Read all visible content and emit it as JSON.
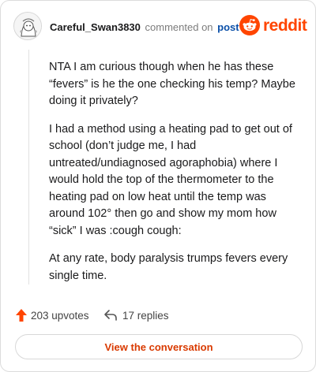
{
  "comment": {
    "username": "Careful_Swan3830",
    "action_text": "commented on",
    "post_link": "post",
    "paragraphs": [
      "NTA I am curious though when he has these “fevers” is he the one checking his temp? Maybe doing it privately?",
      "I had a method using a heating pad to get out of school (don’t judge me, I had untreated/undiagnosed agoraphobia) where I would hold the top of the thermometer to the heating pad on low heat until the temp was around 102° then go and show my mom how “sick” I was :cough cough:",
      "At any rate, body paralysis trumps fevers every single time."
    ]
  },
  "brand": {
    "name": "reddit",
    "color": "#ff4500",
    "icon": "reddit-logo-icon"
  },
  "footer": {
    "upvotes_label": "203 upvotes",
    "replies_label": "17 replies",
    "upvote_icon": "upvote-arrow-icon",
    "reply_icon": "reply-arrow-icon"
  },
  "cta": {
    "label": "View the conversation"
  },
  "colors": {
    "accent": "#ff4500",
    "link": "#0a4fa8",
    "cta_text": "#d93a00"
  }
}
